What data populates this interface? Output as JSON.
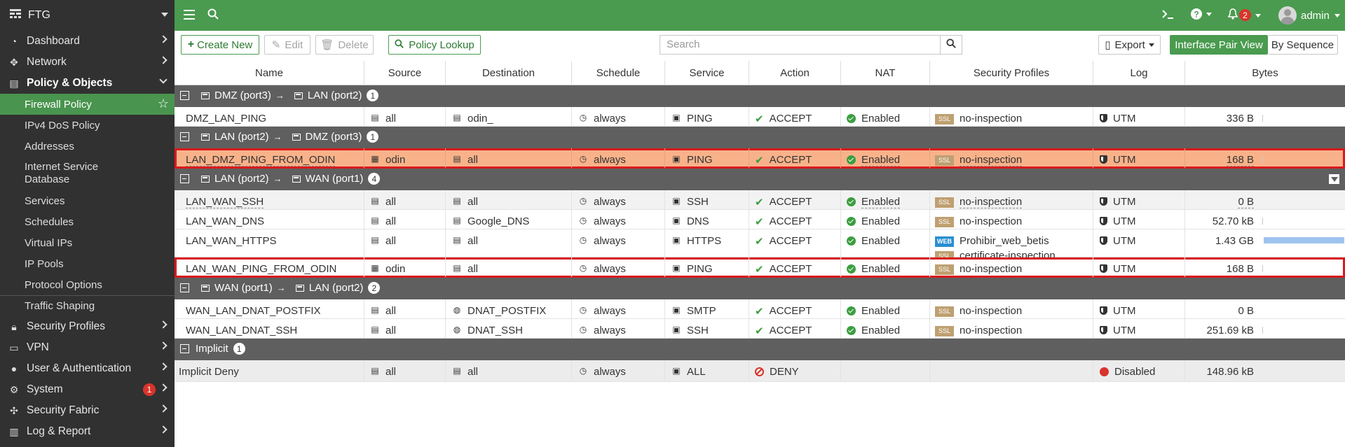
{
  "app": {
    "name": "FTG"
  },
  "sidebar": {
    "items": [
      {
        "label": "Dashboard",
        "icon": "dashboard-icon"
      },
      {
        "label": "Network",
        "icon": "network-icon"
      },
      {
        "label": "Policy & Objects",
        "icon": "policy-icon"
      }
    ],
    "sub_items": [
      "Firewall Policy",
      "IPv4 DoS Policy",
      "Addresses",
      "Internet Service Database",
      "Services",
      "Schedules",
      "Virtual IPs",
      "IP Pools",
      "Protocol Options",
      "Traffic Shaping"
    ],
    "bottom_items": [
      "Security Profiles",
      "VPN",
      "User & Authentication",
      "System",
      "Security Fabric",
      "Log & Report"
    ],
    "system_badge": "1"
  },
  "topbar": {
    "notification_count": "2",
    "user": "admin"
  },
  "toolbar": {
    "create_new": "Create New",
    "edit": "Edit",
    "delete": "Delete",
    "policy_lookup": "Policy Lookup",
    "search_placeholder": "Search",
    "export": "Export",
    "interface_pair_view": "Interface Pair View",
    "by_sequence": "By Sequence"
  },
  "table": {
    "headers": [
      "Name",
      "Source",
      "Destination",
      "Schedule",
      "Service",
      "Action",
      "NAT",
      "Security Profiles",
      "Log",
      "Bytes"
    ],
    "groups": [
      {
        "from": "DMZ (port3)",
        "to": "LAN (port2)",
        "count": "1"
      },
      {
        "from": "LAN (port2)",
        "to": "DMZ (port3)",
        "count": "1"
      },
      {
        "from": "LAN (port2)",
        "to": "WAN (port1)",
        "count": "4"
      },
      {
        "from": "WAN (port1)",
        "to": "LAN (port2)",
        "count": "2"
      }
    ],
    "implicit_group": {
      "label": "Implicit",
      "count": "1"
    },
    "rows": [
      {
        "name": "DMZ_LAN_PING",
        "source": "all",
        "destination": "odin_",
        "schedule": "always",
        "service": "PING",
        "action": "ACCEPT",
        "nat": "Enabled",
        "profile1": "no-inspection",
        "profile2": "",
        "log": "UTM",
        "bytes": "336 B"
      },
      {
        "name": "LAN_DMZ_PING_FROM_ODIN",
        "source": "odin",
        "destination": "all",
        "schedule": "always",
        "service": "PING",
        "action": "ACCEPT",
        "nat": "Enabled",
        "profile1": "no-inspection",
        "profile2": "",
        "log": "UTM",
        "bytes": "168 B"
      },
      {
        "name": "LAN_WAN_SSH",
        "source": "all",
        "destination": "all",
        "schedule": "always",
        "service": "SSH",
        "action": "ACCEPT",
        "nat": "Enabled",
        "profile1": "no-inspection",
        "profile2": "",
        "log": "UTM",
        "bytes": "0 B"
      },
      {
        "name": "LAN_WAN_DNS",
        "source": "all",
        "destination": "Google_DNS",
        "schedule": "always",
        "service": "DNS",
        "action": "ACCEPT",
        "nat": "Enabled",
        "profile1": "no-inspection",
        "profile2": "",
        "log": "UTM",
        "bytes": "52.70 kB"
      },
      {
        "name": "LAN_WAN_HTTPS",
        "source": "all",
        "destination": "all",
        "schedule": "always",
        "service": "HTTPS",
        "action": "ACCEPT",
        "nat": "Enabled",
        "profile1": "Prohibir_web_betis",
        "profile2": "certificate-inspection",
        "log": "UTM",
        "bytes": "1.43 GB"
      },
      {
        "name": "LAN_WAN_PING_FROM_ODIN",
        "source": "odin",
        "destination": "all",
        "schedule": "always",
        "service": "PING",
        "action": "ACCEPT",
        "nat": "Enabled",
        "profile1": "no-inspection",
        "profile2": "",
        "log": "UTM",
        "bytes": "168 B"
      },
      {
        "name": "WAN_LAN_DNAT_POSTFIX",
        "source": "all",
        "destination": "DNAT_POSTFIX",
        "schedule": "always",
        "service": "SMTP",
        "action": "ACCEPT",
        "nat": "Enabled",
        "profile1": "no-inspection",
        "profile2": "",
        "log": "UTM",
        "bytes": "0 B"
      },
      {
        "name": "WAN_LAN_DNAT_SSH",
        "source": "all",
        "destination": "DNAT_SSH",
        "schedule": "always",
        "service": "SSH",
        "action": "ACCEPT",
        "nat": "Enabled",
        "profile1": "no-inspection",
        "profile2": "",
        "log": "UTM",
        "bytes": "251.69 kB"
      },
      {
        "name": "Implicit Deny",
        "source": "all",
        "destination": "all",
        "schedule": "always",
        "service": "ALL",
        "action": "DENY",
        "nat": "",
        "profile1": "",
        "profile2": "",
        "log": "Disabled",
        "bytes": "148.96 kB"
      }
    ],
    "bytes_bar_fraction": 0.96,
    "ssl_tag": "SSL",
    "web_tag": "WEB"
  },
  "colors": {
    "accent": "#4a9b4f",
    "sidebar": "#313131",
    "group_row": "#5f5f5f",
    "selected_row": "#f8b28a",
    "highlight": "#d9191d"
  }
}
